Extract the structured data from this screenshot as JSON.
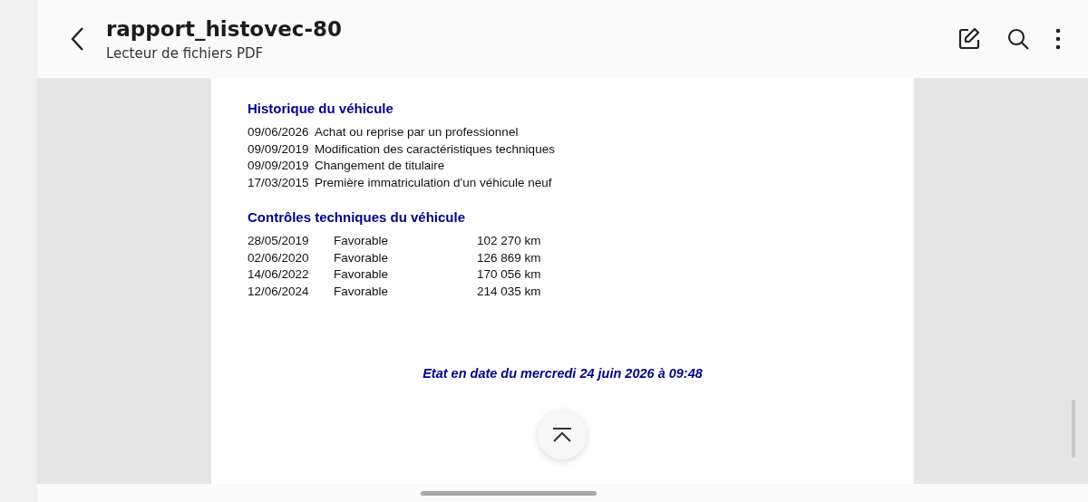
{
  "header": {
    "title": "rapport_histovec-80",
    "subtitle": "Lecteur de fichiers PDF"
  },
  "document": {
    "history": {
      "heading": "Historique du véhicule",
      "rows": [
        {
          "date": "09/06/2026",
          "event": "Achat ou reprise par un professionnel"
        },
        {
          "date": "09/09/2019",
          "event": "Modification des caractéristiques techniques"
        },
        {
          "date": "09/09/2019",
          "event": "Changement de titulaire"
        },
        {
          "date": "17/03/2015",
          "event": "Première immatriculation d'un véhicule neuf"
        }
      ]
    },
    "inspections": {
      "heading": "Contrôles techniques du véhicule",
      "rows": [
        {
          "date": "28/05/2019",
          "result": "Favorable",
          "mileage": "102 270 km"
        },
        {
          "date": "02/06/2020",
          "result": "Favorable",
          "mileage": "126 869 km"
        },
        {
          "date": "14/06/2022",
          "result": "Favorable",
          "mileage": "170 056 km"
        },
        {
          "date": "12/06/2024",
          "result": "Favorable",
          "mileage": "214 035 km"
        }
      ]
    },
    "footer": "Etat en date du mercredi 24 juin 2026 à 09:48"
  }
}
